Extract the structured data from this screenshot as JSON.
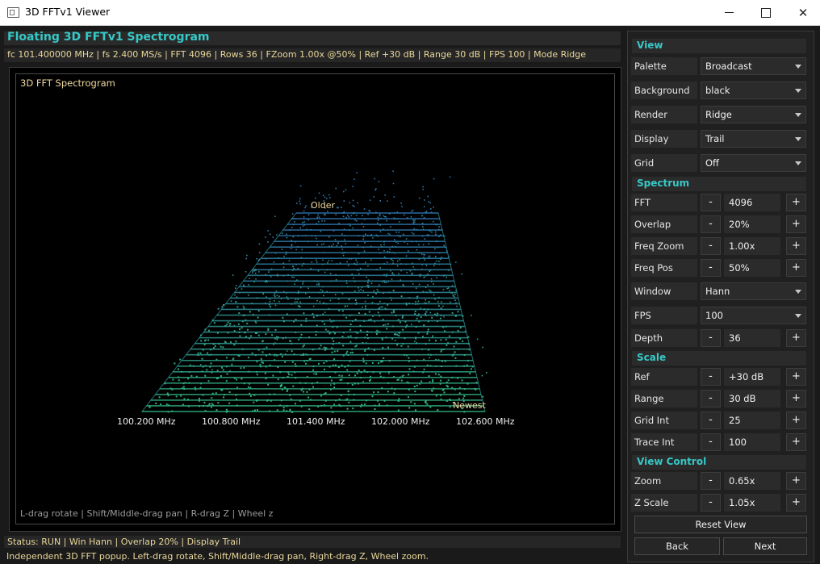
{
  "window": {
    "title": "3D FFTv1 Viewer",
    "icon": "app-window-icon",
    "controls": [
      "minimize-icon",
      "maximize-icon",
      "close-icon"
    ]
  },
  "heading": "Floating 3D FFTv1 Spectrogram",
  "info_line": "fc 101.400000 MHz | fs 2.400 MS/s | FFT 4096 | Rows 36 | FZoom 1.00x @50% | Ref +30 dB | Range 30 dB | FPS 100 | Mode Ridge",
  "plot": {
    "title": "3D FFT Spectrogram",
    "older_label": "Older",
    "newest_label": "Newest",
    "freq_ticks": [
      "100.200 MHz",
      "100.800 MHz",
      "101.400 MHz",
      "102.000 MHz",
      "102.600 MHz"
    ],
    "help": "L-drag rotate | Shift/Middle-drag pan | R-drag Z | Wheel z",
    "colors": {
      "far": "#2e6fb0",
      "near": "#2fb07a",
      "frame": "#2aa0a8",
      "text": "#f0d9a0"
    }
  },
  "status": "Status: RUN | Win Hann | Overlap 20% | Display Trail",
  "hint": "Independent 3D FFT popup. Left-drag rotate, Shift/Middle-drag pan, Right-drag Z, Wheel zoom.",
  "panel": {
    "view": {
      "title": "View",
      "palette": {
        "label": "Palette",
        "value": "Broadcast"
      },
      "background": {
        "label": "Background",
        "value": "black"
      },
      "render": {
        "label": "Render",
        "value": "Ridge"
      },
      "display": {
        "label": "Display",
        "value": "Trail"
      },
      "grid": {
        "label": "Grid",
        "value": "Off"
      }
    },
    "spectrum": {
      "title": "Spectrum",
      "fft": {
        "label": "FFT",
        "value": "4096"
      },
      "overlap": {
        "label": "Overlap",
        "value": "20%"
      },
      "freq_zoom": {
        "label": "Freq Zoom",
        "value": "1.00x"
      },
      "freq_pos": {
        "label": "Freq Pos",
        "value": "50%"
      },
      "window": {
        "label": "Window",
        "value": "Hann"
      },
      "fps": {
        "label": "FPS",
        "value": "100"
      },
      "depth": {
        "label": "Depth",
        "value": "36"
      }
    },
    "scale": {
      "title": "Scale",
      "ref": {
        "label": "Ref",
        "value": "+30 dB"
      },
      "range": {
        "label": "Range",
        "value": "30 dB"
      },
      "grid_int": {
        "label": "Grid Int",
        "value": "25"
      },
      "trace_int": {
        "label": "Trace Int",
        "value": "100"
      }
    },
    "view_control": {
      "title": "View Control",
      "zoom": {
        "label": "Zoom",
        "value": "0.65x"
      },
      "z_scale": {
        "label": "Z Scale",
        "value": "1.05x"
      }
    },
    "minus": "-",
    "plus": "+",
    "reset_view": "Reset View",
    "back": "Back",
    "next": "Next"
  }
}
